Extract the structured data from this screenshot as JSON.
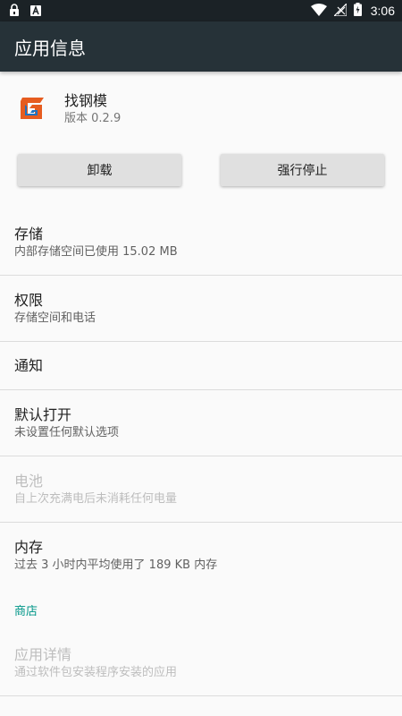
{
  "status_bar": {
    "time": "3:06",
    "left_icons": [
      "lock-icon",
      "a-notification-icon"
    ],
    "right_icons": [
      "wifi-icon",
      "no-signal-icon",
      "battery-charging-icon"
    ]
  },
  "app_bar": {
    "title": "应用信息"
  },
  "app": {
    "name": "找钢模",
    "version": "版本 0.2.9",
    "icon": "app-logo-icon"
  },
  "buttons": {
    "uninstall": "卸载",
    "force_stop": "强行停止"
  },
  "prefs": {
    "storage": {
      "title": "存储",
      "summary": "内部存储空间已使用 15.02 MB"
    },
    "permissions": {
      "title": "权限",
      "summary": "存储空间和电话"
    },
    "notifications": {
      "title": "通知"
    },
    "open_by_default": {
      "title": "默认打开",
      "summary": "未设置任何默认选项"
    },
    "battery": {
      "title": "电池",
      "summary": "自上次充满电后未消耗任何电量"
    },
    "memory": {
      "title": "内存",
      "summary": "过去 3 小时内平均使用了 189 KB 内存"
    }
  },
  "store": {
    "category": "商店",
    "app_details": {
      "title": "应用详情",
      "summary": "通过软件包安装程序安装的应用"
    }
  },
  "colors": {
    "status_bar": "#1b2226",
    "app_bar": "#263238",
    "accent": "#009688",
    "background": "#fafafa"
  }
}
